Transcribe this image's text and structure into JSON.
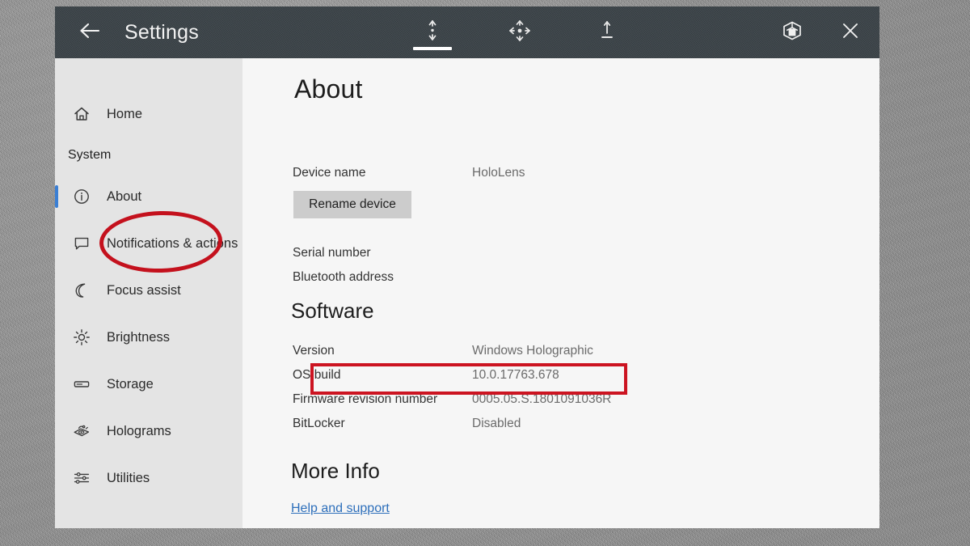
{
  "window": {
    "titlebar": {
      "back_icon": "back-arrow-icon",
      "title": "Settings",
      "chrome_buttons": [
        {
          "icon": "resize-vertical-icon",
          "label": "Adjust",
          "active": true
        },
        {
          "icon": "move-four-arrows-icon",
          "label": "Move",
          "active": false
        },
        {
          "icon": "follow-pin-icon",
          "label": "Follow",
          "active": false
        }
      ],
      "right_buttons": [
        {
          "icon": "mixed-reality-cube-icon",
          "label": "Mixed reality capture"
        },
        {
          "icon": "close-icon",
          "label": "Close"
        }
      ]
    }
  },
  "sidebar": {
    "home": {
      "icon": "home-icon",
      "label": "Home"
    },
    "group_title": "System",
    "items": [
      {
        "icon": "info-circle-icon",
        "label": "About",
        "selected": true
      },
      {
        "icon": "notification-icon",
        "label": "Notifications & actions",
        "selected": false
      },
      {
        "icon": "moon-icon",
        "label": "Focus assist",
        "selected": false
      },
      {
        "icon": "brightness-sun-icon",
        "label": "Brightness",
        "selected": false
      },
      {
        "icon": "storage-drive-icon",
        "label": "Storage",
        "selected": false
      },
      {
        "icon": "holograms-icon",
        "label": "Holograms",
        "selected": false
      },
      {
        "icon": "utilities-sliders-icon",
        "label": "Utilities",
        "selected": false
      }
    ]
  },
  "content": {
    "page_title": "About",
    "device": {
      "rows": [
        {
          "key": "Device name",
          "value": "HoloLens"
        }
      ],
      "rename_button": "Rename device",
      "extra_rows": [
        {
          "key": "Serial number",
          "value": ""
        },
        {
          "key": "Bluetooth address",
          "value": ""
        }
      ]
    },
    "software": {
      "heading": "Software",
      "rows": [
        {
          "key": "Version",
          "value": "Windows Holographic"
        },
        {
          "key": "OS build",
          "value": "10.0.17763.678"
        },
        {
          "key": "Firmware revision number",
          "value": "0005.05.S.1801091036R"
        },
        {
          "key": "BitLocker",
          "value": "Disabled"
        }
      ]
    },
    "more_info": {
      "heading": "More Info",
      "link": "Help and support"
    }
  },
  "annotations": {
    "ellipse_target": "About",
    "rect_target": "OS build",
    "color": "#c4111d"
  },
  "colors": {
    "titlebar": "#3a4247",
    "sidebar": "#e4e4e4",
    "content": "#f6f6f6",
    "accent_selection": "#3b7fd4",
    "link": "#2d6fbb",
    "annotation_red": "#c4111d",
    "button_face": "#cccccc",
    "backdrop": "#9b9b9b"
  }
}
